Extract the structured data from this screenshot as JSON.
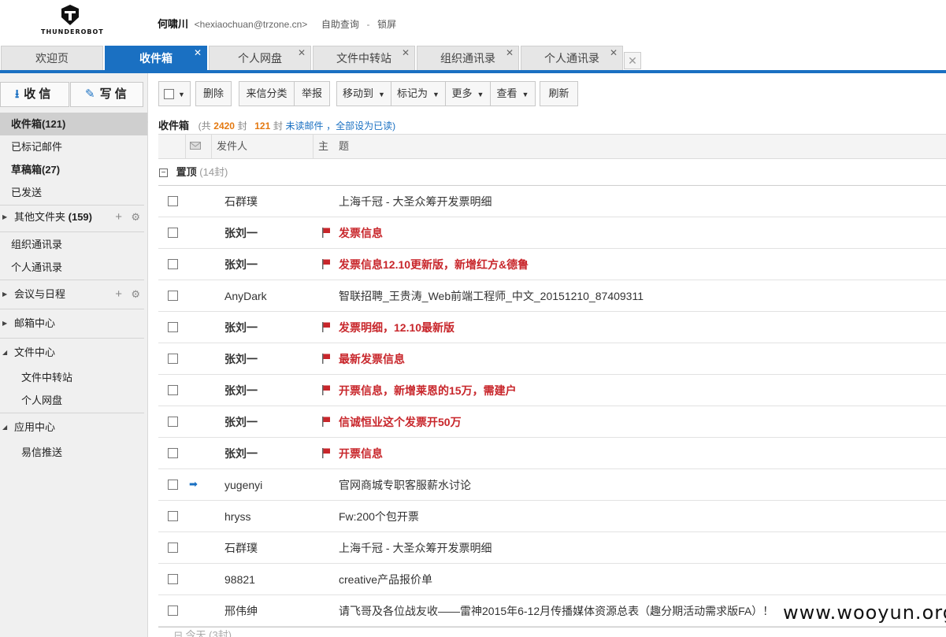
{
  "header": {
    "brand": "THUNDEROBOT",
    "user_name": "何啸川",
    "user_email": "<hexiaochuan@trzone.cn>",
    "self_query": "自助查询",
    "separator": "-",
    "lock": "锁屏"
  },
  "tabs": [
    {
      "label": "欢迎页",
      "active": false,
      "closable": false
    },
    {
      "label": "收件箱",
      "active": true,
      "closable": true
    },
    {
      "label": "个人网盘",
      "active": false,
      "closable": true
    },
    {
      "label": "文件中转站",
      "active": false,
      "closable": true
    },
    {
      "label": "组织通讯录",
      "active": false,
      "closable": true
    },
    {
      "label": "个人通讯录",
      "active": false,
      "closable": true
    }
  ],
  "sidebar": {
    "receive_label": "收 信",
    "write_label": "写 信",
    "items": [
      {
        "label": "收件箱(121)"
      },
      {
        "label": "已标记邮件"
      },
      {
        "label": "草稿箱(27)"
      },
      {
        "label": "已发送"
      },
      {
        "label": "其他文件夹",
        "count": "(159)"
      },
      {
        "label": "组织通讯录"
      },
      {
        "label": "个人通讯录"
      },
      {
        "label": "会议与日程"
      },
      {
        "label": "邮箱中心"
      },
      {
        "label": "文件中心"
      },
      {
        "label": "文件中转站"
      },
      {
        "label": "个人网盘"
      },
      {
        "label": "应用中心"
      },
      {
        "label": "易信推送"
      }
    ],
    "plus_icon": "+",
    "gear_icon": "⚙"
  },
  "toolbar": {
    "delete": "删除",
    "categorize": "来信分类",
    "report": "举报",
    "move_to": "移动到",
    "mark_as": "标记为",
    "more": "更多",
    "view": "查看",
    "refresh": "刷新"
  },
  "folder": {
    "title": "收件箱",
    "total_prefix": "(共",
    "total": "2420",
    "total_suffix": "封",
    "unread": "121",
    "unread_suffix": "封",
    "unread_link": "未读邮件",
    "mark_all": "，全部设为已读)"
  },
  "columns": {
    "sender": "发件人",
    "subject": "主　题"
  },
  "group": {
    "title": "置顶",
    "count": "(14封)"
  },
  "emails": [
    {
      "sender": "石群璞",
      "subject": "上海千冠 - 大圣众筹开发票明细",
      "flag": false,
      "bold": false,
      "status": ""
    },
    {
      "sender": "张刘一",
      "subject": "发票信息",
      "flag": true,
      "bold": true,
      "status": ""
    },
    {
      "sender": "张刘一",
      "subject": "发票信息12.10更新版，新增红方&德鲁",
      "flag": true,
      "bold": true,
      "status": ""
    },
    {
      "sender": "AnyDark",
      "subject": "智联招聘_王贵涛_Web前端工程师_中文_20151210_87409311",
      "flag": false,
      "bold": false,
      "status": ""
    },
    {
      "sender": "张刘一",
      "subject": "发票明细，12.10最新版",
      "flag": true,
      "bold": true,
      "status": ""
    },
    {
      "sender": "张刘一",
      "subject": "最新发票信息",
      "flag": true,
      "bold": true,
      "status": ""
    },
    {
      "sender": "张刘一",
      "subject": "开票信息，新增莱恩的15万，需建户",
      "flag": true,
      "bold": true,
      "status": ""
    },
    {
      "sender": "张刘一",
      "subject": "信诚恒业这个发票开50万",
      "flag": true,
      "bold": true,
      "status": ""
    },
    {
      "sender": "张刘一",
      "subject": "开票信息",
      "flag": true,
      "bold": true,
      "status": ""
    },
    {
      "sender": "yugenyi",
      "subject": "官网商城专职客服薪水讨论",
      "flag": false,
      "bold": false,
      "status": "➡"
    },
    {
      "sender": "hryss",
      "subject": "Fw:200个包开票",
      "flag": false,
      "bold": false,
      "status": ""
    },
    {
      "sender": "石群璞",
      "subject": "上海千冠 - 大圣众筹开发票明细",
      "flag": false,
      "bold": false,
      "status": ""
    },
    {
      "sender": "98821",
      "subject": "creative产品报价单",
      "flag": false,
      "bold": false,
      "status": ""
    },
    {
      "sender": "邢伟绅",
      "subject": "请飞哥及各位战友收——雷神2015年6-12月传播媒体资源总表（趣分期活动需求版FA）！",
      "flag": false,
      "bold": false,
      "status": ""
    }
  ],
  "bottom_group": "⊟ 今天 (3封)",
  "watermark": "www.wooyun.org",
  "colors": {
    "accent": "#1a70c2",
    "flag_red": "#c8262b",
    "count_orange": "#e47911"
  }
}
